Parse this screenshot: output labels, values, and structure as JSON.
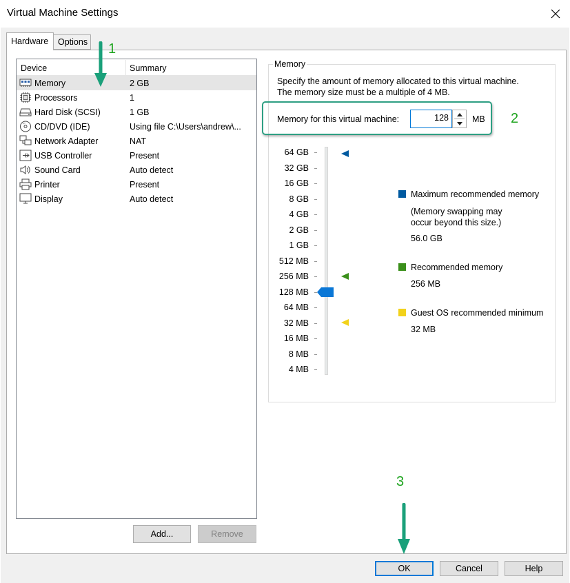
{
  "window": {
    "title": "Virtual Machine Settings"
  },
  "tabs": [
    {
      "label": "Hardware"
    },
    {
      "label": "Options"
    }
  ],
  "device_list": {
    "columns": {
      "device": "Device",
      "summary": "Summary"
    },
    "rows": [
      {
        "device": "Memory",
        "summary": "2 GB",
        "icon": "memory-icon",
        "selected": true
      },
      {
        "device": "Processors",
        "summary": "1",
        "icon": "processor-icon"
      },
      {
        "device": "Hard Disk (SCSI)",
        "summary": "1 GB",
        "icon": "hard-disk-icon"
      },
      {
        "device": "CD/DVD (IDE)",
        "summary": "Using file C:\\Users\\andrew\\...",
        "icon": "cd-dvd-icon"
      },
      {
        "device": "Network Adapter",
        "summary": "NAT",
        "icon": "network-adapter-icon"
      },
      {
        "device": "USB Controller",
        "summary": "Present",
        "icon": "usb-icon"
      },
      {
        "device": "Sound Card",
        "summary": "Auto detect",
        "icon": "speaker-icon"
      },
      {
        "device": "Printer",
        "summary": "Present",
        "icon": "printer-icon"
      },
      {
        "device": "Display",
        "summary": "Auto detect",
        "icon": "monitor-icon"
      }
    ]
  },
  "list_buttons": {
    "add": "Add...",
    "remove": "Remove"
  },
  "memory": {
    "group_label": "Memory",
    "description_line1": "Specify the amount of memory allocated to this virtual machine.",
    "description_line2": "The memory size must be a multiple of 4 MB.",
    "field_label": "Memory for this virtual machine:",
    "value": "128",
    "unit": "MB",
    "scale_labels": [
      "64 GB",
      "32 GB",
      "16 GB",
      "8 GB",
      "4 GB",
      "2 GB",
      "1 GB",
      "512 MB",
      "256 MB",
      "128 MB",
      "64 MB",
      "32 MB",
      "16 MB",
      "8 MB",
      "4 MB"
    ],
    "slider_value_index": 9,
    "legend": {
      "max": {
        "title": "Maximum recommended memory",
        "note_line1": "(Memory swapping may",
        "note_line2": "occur beyond this size.)",
        "value": "56.0 GB",
        "color": "#005aa0",
        "scale_index": 0
      },
      "recommended": {
        "title": "Recommended memory",
        "value": "256 MB",
        "color": "#3a8f1a",
        "scale_index": 8
      },
      "guest_min": {
        "title": "Guest OS recommended minimum",
        "value": "32 MB",
        "color": "#f2d21b",
        "scale_index": 11
      }
    }
  },
  "footer_buttons": {
    "ok": "OK",
    "cancel": "Cancel",
    "help": "Help"
  },
  "annotations": {
    "step1": "1",
    "step2": "2",
    "step3": "3",
    "color": "#1aa07a"
  }
}
